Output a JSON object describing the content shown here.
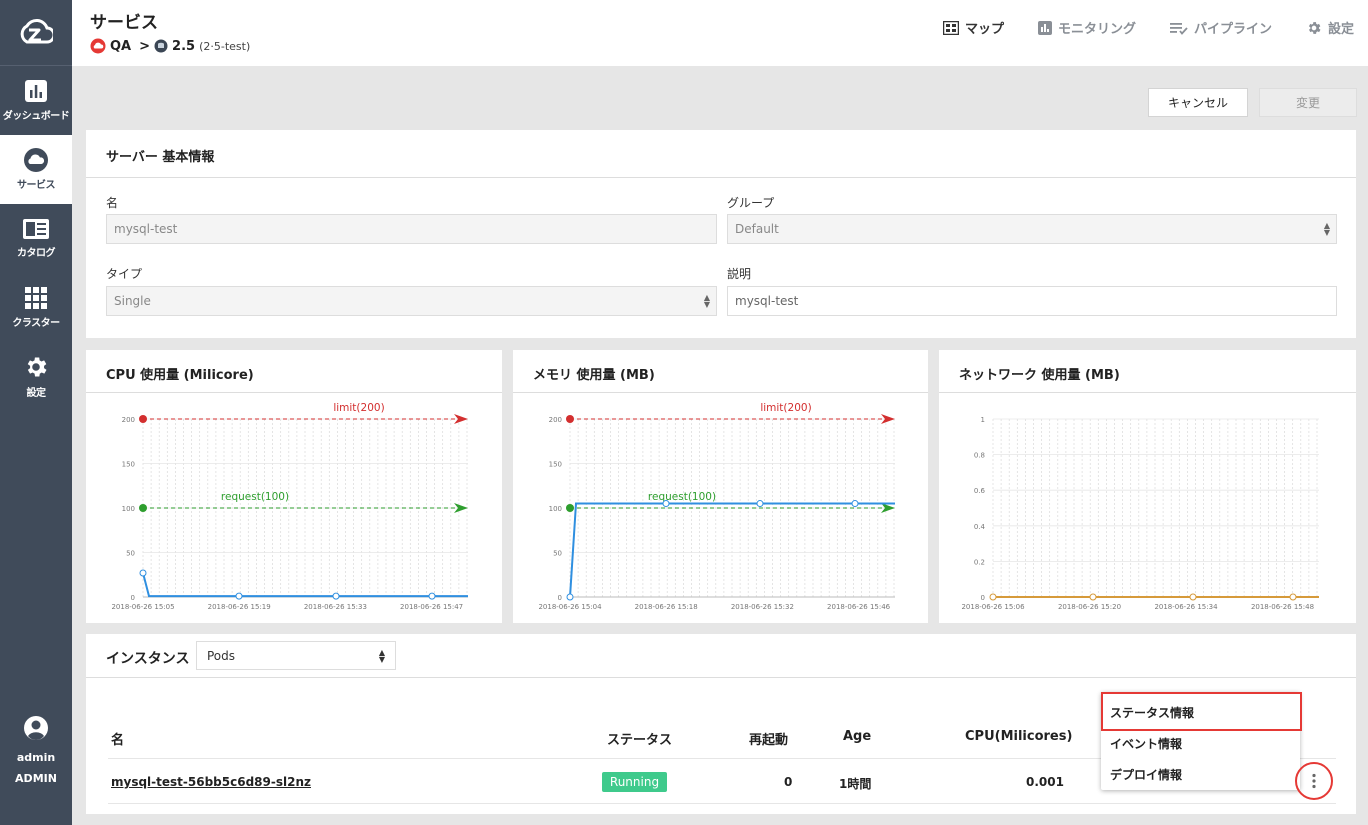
{
  "sidebar": {
    "items": [
      {
        "label": "ダッシュボード",
        "icon": "dashboard-icon"
      },
      {
        "label": "サービス",
        "icon": "cloud-icon"
      },
      {
        "label": "カタログ",
        "icon": "catalog-icon"
      },
      {
        "label": "クラスター",
        "icon": "cluster-grid-icon"
      },
      {
        "label": "設定",
        "icon": "gear-icon"
      }
    ],
    "user": {
      "name": "admin",
      "role": "ADMIN"
    }
  },
  "header": {
    "title": "サービス",
    "breadcrumb": {
      "workspace": "QA",
      "separator": ">",
      "service": "2.5",
      "service_detail": "(2·5-test)"
    },
    "nav": [
      {
        "label": "マップ",
        "icon": "map-icon"
      },
      {
        "label": "モニタリング",
        "icon": "monitoring-icon"
      },
      {
        "label": "パイプライン",
        "icon": "pipeline-icon"
      },
      {
        "label": "設定",
        "icon": "gear-icon"
      }
    ]
  },
  "actions": {
    "cancel": "キャンセル",
    "change": "変更"
  },
  "basic_info": {
    "title": "サーバー 基本情報",
    "name_label": "名",
    "name_value": "mysql-test",
    "group_label": "グループ",
    "group_value": "Default",
    "type_label": "タイプ",
    "type_value": "Single",
    "desc_label": "説明",
    "desc_value": "mysql-test"
  },
  "chart_data": [
    {
      "type": "line",
      "title": "CPU 使用量 (Milicore)",
      "ylim": [
        0,
        200
      ],
      "yticks": [
        "0",
        "50",
        "100",
        "150",
        "200"
      ],
      "xticks": [
        "2018-06-26 15:05",
        "2018-06-26 15:19",
        "2018-06-26 15:33",
        "2018-06-26 15:47"
      ],
      "series": [
        {
          "values": [
            27,
            1,
            1,
            1,
            1,
            1
          ]
        }
      ],
      "annotations": [
        {
          "label": "limit(200)",
          "value": 200
        },
        {
          "label": "request(100)",
          "value": 100
        }
      ]
    },
    {
      "type": "line",
      "title": "メモリ 使用量 (MB)",
      "ylim": [
        0,
        200
      ],
      "yticks": [
        "0",
        "50",
        "100",
        "150",
        "200"
      ],
      "xticks": [
        "2018-06-26 15:04",
        "2018-06-26 15:18",
        "2018-06-26 15:32",
        "2018-06-26 15:46"
      ],
      "series": [
        {
          "values": [
            0,
            105,
            105,
            105,
            105,
            105
          ]
        }
      ],
      "annotations": [
        {
          "label": "limit(200)",
          "value": 200
        },
        {
          "label": "request(100)",
          "value": 100
        }
      ]
    },
    {
      "type": "line",
      "title": "ネットワーク 使用量 (MB)",
      "ylim": [
        0,
        1
      ],
      "yticks": [
        "0",
        "0.2",
        "0.4",
        "0.6",
        "0.8",
        "1"
      ],
      "xticks": [
        "2018-06-26 15:06",
        "2018-06-26 15:20",
        "2018-06-26 15:34",
        "2018-06-26 15:48"
      ],
      "series": [
        {
          "values": [
            0,
            0,
            0,
            0,
            0
          ]
        }
      ]
    }
  ],
  "instances": {
    "title": "インスタンス",
    "filter": "Pods",
    "columns": [
      "名",
      "ステータス",
      "再起動",
      "Age",
      "CPU(Milicores)"
    ],
    "rows": [
      {
        "name": "mysql-test-56bb5c6d89-sl2nz",
        "status": "Running",
        "restarts": "0",
        "age": "1時間",
        "cpu": "0.001"
      }
    ]
  },
  "context_menu": {
    "items": [
      "ステータス情報",
      "イベント情報",
      "デプロイ情報"
    ]
  },
  "colors": {
    "limit": "#d32f2f",
    "request": "#2e9e2e",
    "cpu_line": "#2f8fe0",
    "network_line": "#d69a3a",
    "running": "#3fca8c",
    "sidebar": "#404b5a",
    "highlight": "#e53935"
  }
}
